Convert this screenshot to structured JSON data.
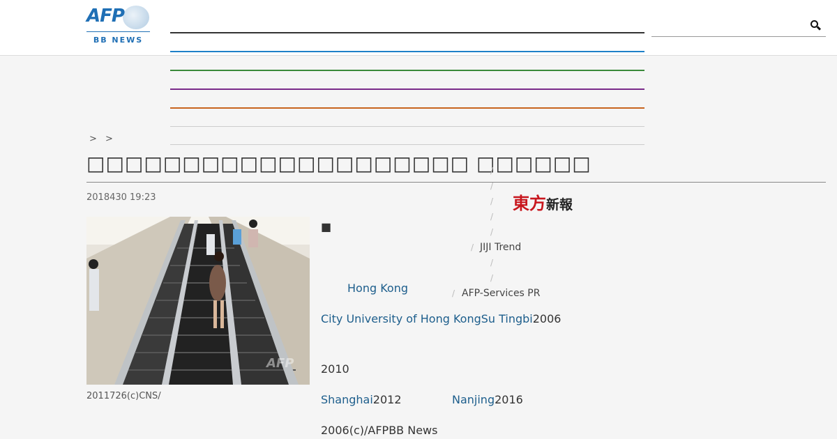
{
  "header": {
    "logo": {
      "main": "AFP",
      "sub": "BB NEWS"
    },
    "nav_lines": [
      "#333333",
      "#1e80c8",
      "#3a8a3a",
      "#7a2a8a",
      "#c8641e",
      "#cccccc",
      "#cccccc"
    ],
    "search": {
      "value": "",
      "placeholder": ""
    }
  },
  "breadcrumb": [
    ">",
    ">"
  ],
  "article": {
    "title": "□□□□□□□□□□□□□□□□□□□□ □□□□□□",
    "date": "2018430 19:23",
    "photo_caption": "2011726(c)CNS/",
    "bullet": "■",
    "paragraphs": [
      {
        "link": "Hong Kong"
      },
      {
        "link1": "City University of Hong Kong",
        "link2": "Su Tingbi",
        "text": "2006"
      },
      {
        "text": "2010"
      },
      {
        "link1": "Shanghai",
        "text1": "2012",
        "link2": "Nanjing",
        "text2": "2016"
      },
      {
        "text": "2006(c)/AFPBB News"
      }
    ]
  },
  "sidebar": {
    "slash": "/",
    "logo": {
      "red": "東方",
      "black": "新報"
    },
    "items": [
      "JIJI Trend",
      "AFP-Services PR"
    ]
  }
}
